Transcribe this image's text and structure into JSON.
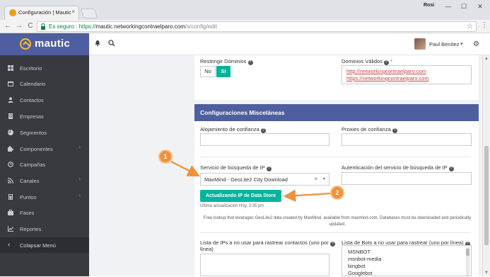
{
  "browser": {
    "tab_title": "Configuración | Mautic",
    "tab_close": "×",
    "user_label": "Rosi",
    "win_minimize": "—",
    "win_maximize": "☐",
    "win_close": "✕",
    "secure_label": "Es seguro",
    "url_scheme": "https://",
    "url_domain": "mautic.networkingcontraelparo.com",
    "url_path": "/s/config/edit",
    "back_glyph": "←",
    "forward_glyph": "→",
    "reload_glyph": "C",
    "star_glyph": "☆",
    "menu_glyph": "⋮"
  },
  "header": {
    "brand": "mautic",
    "bell_glyph": "🔔",
    "search_glyph": "⚲",
    "user_name": "Paul Benítez",
    "caret": "▾",
    "gear_glyph": "⚙"
  },
  "sidebar": {
    "items": [
      {
        "label": "Escritorio",
        "icon": "dashboard-icon",
        "has_arrow": false
      },
      {
        "label": "Calendario",
        "icon": "calendar-icon",
        "has_arrow": false
      },
      {
        "label": "Contactos",
        "icon": "user-icon",
        "has_arrow": false
      },
      {
        "label": "Empresas",
        "icon": "building-icon",
        "has_arrow": false
      },
      {
        "label": "Segmentos",
        "icon": "pie-chart-icon",
        "has_arrow": false
      },
      {
        "label": "Componentes",
        "icon": "puzzle-icon",
        "has_arrow": true
      },
      {
        "label": "Campañas",
        "icon": "clock-icon",
        "has_arrow": false
      },
      {
        "label": "Canales",
        "icon": "rss-icon",
        "has_arrow": true
      },
      {
        "label": "Puntos",
        "icon": "calculator-icon",
        "has_arrow": true
      },
      {
        "label": "Fases",
        "icon": "briefcase-icon",
        "has_arrow": false
      },
      {
        "label": "Reportes",
        "icon": "line-chart-icon",
        "has_arrow": false
      }
    ],
    "arrow": "›",
    "collapse_label": "Colapsar Menú",
    "collapse_glyph": "‹"
  },
  "form": {
    "restrict_domains_label": "Restringir Dominios",
    "no_label": "No",
    "yes_label": "Sí",
    "valid_domains_label": "Dominios Válidos",
    "required_mark": "*",
    "valid_domains": [
      "http://networkingcontraelparo.com",
      "https://networkingcontraelparo.com"
    ],
    "misc_heading": "Configuraciones Misceláneas",
    "trusted_hosts_label": "Alojamiento de confianza",
    "trusted_proxies_label": "Proxies de confianza",
    "ip_lookup_service_label": "Servicio de búsqueda de IP",
    "ip_lookup_service_value": "MaxMind - GeoLite2 City Download",
    "clear_glyph": "×",
    "select_caret": "▾",
    "ip_lookup_auth_label": "Autenticación del servicio de búsqueda de IP",
    "update_button": "Actualizando IP de Data Store",
    "last_update": "Última actualización Hoy, 3:35 pm",
    "lookup_help": "Free lookup that leverages GeoLite2 data created by MaxMind, available from maxmind.com. Databases must be downloaded and periodically updated.",
    "ips_no_track_label_1": "Lista de IPs a no usar para rastrear contactos (uno por",
    "ips_no_track_label_2": "línea)",
    "bots_no_track_label": "Lista de Bots a no usar para rastrear (uno por línea)",
    "bots": [
      "MSNBOT",
      "msnbot-media",
      "bingbot",
      "Googlebot"
    ],
    "help_glyph": "?"
  },
  "annotations": {
    "callout_1": "1",
    "callout_2": "2",
    "color": "#f0913a"
  },
  "colors": {
    "brand": "#4e5e9e",
    "accent": "#00b49c",
    "sidebar": "#373a3f"
  }
}
